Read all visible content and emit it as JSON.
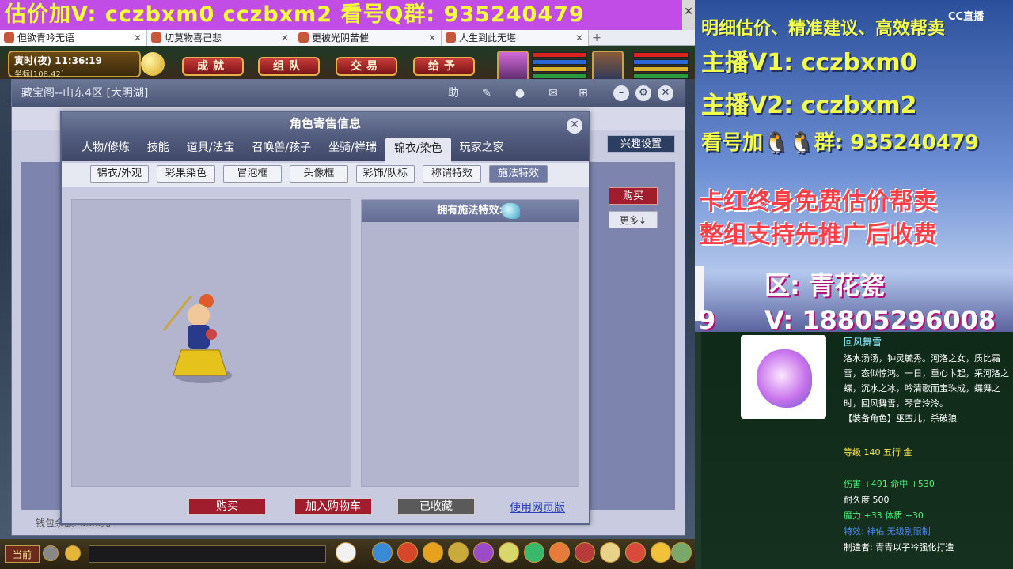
{
  "banner": {
    "text": "估价加V:  cczbxm0   cczbxm2   看号Q群: 935240479",
    "close": "✕"
  },
  "browser_tabs": [
    {
      "label": "但欲青吟无语",
      "close": "✕"
    },
    {
      "label": "切莫物喜己悲",
      "close": "✕"
    },
    {
      "label": "更被光阴苦催",
      "close": "✕"
    },
    {
      "label": "人生到此无堪",
      "close": "✕"
    }
  ],
  "new_tab": "+",
  "hud": {
    "clock": "寅时(夜)  11:36:19",
    "location": "坐标[108,42]",
    "buttons": [
      "成就",
      "组队",
      "交易",
      "给予"
    ]
  },
  "cbg": {
    "title": "藏宝阁--山东4区 [大明湖]",
    "interest_button": "兴趣设置",
    "buy_button": "购买",
    "more_button": "更多↓",
    "wallet": "钱包余额: 0.00元"
  },
  "dialog": {
    "title": "角色寄售信息",
    "close": "✕",
    "tabs": [
      "人物/修炼",
      "技能",
      "道具/法宝",
      "召唤兽/孩子",
      "坐骑/祥瑞",
      "锦衣/染色",
      "玩家之家"
    ],
    "active_tab": "锦衣/染色",
    "subtabs": [
      "锦衣/外观",
      "彩果染色",
      "冒泡框",
      "头像框",
      "彩饰/队标",
      "称谓特效",
      "施法特效"
    ],
    "active_subtab": "施法特效",
    "fx_header": "拥有施法特效:",
    "buttons": {
      "buy": "购买",
      "add_cart": "加入购物车",
      "favorited": "已收藏",
      "web_link": "使用网页版"
    }
  },
  "bottom_bar": {
    "current": "当前"
  },
  "overlay": {
    "cc_logo": "CC直播",
    "promo_1": "明细估价、精准建议、高效帮卖",
    "promo_2": "主播V1: cczbxm0",
    "promo_3": "主播V2: cczbxm2",
    "promo_4": "看号加🐧🐧群: 935240479",
    "promo_5": "卡红终身免费估价帮卖",
    "promo_6": "整组支持先推广后收费",
    "region": "区: 青花瓷",
    "contact_prefix": "9",
    "contact": "V: 18805296008"
  },
  "item": {
    "name": "回风舞雪",
    "desc": "洛水汤汤，钟灵毓秀。河洛之女，质比霜雪，态似惊鸿。一日，重心卞起，采河洛之蝶，沉水之冰，吟清歌而宝珠成，蝶舞之时，回风舞雪，琴音泠泠。",
    "equip_role": "【装备角色】巫蛮儿，杀破狼",
    "level_line": "等级 140 五行 金",
    "dmg_line": "伤害 +491 命中 +530",
    "durability_line": "耐久度 500",
    "attr_line": "魔力 +33 体质 +30",
    "effect_line": "特效: 神佑 无级别限制",
    "maker_line": "制造者: 青青以子衿强化打造"
  },
  "colors": {
    "banner_bg": "#c24de6",
    "banner_text": "#f4ff3a",
    "promo_yellow": "#f3ff4d",
    "promo_red": "#ff3f48",
    "buy_red": "#a01d2d",
    "link_blue": "#2a3fb8"
  }
}
